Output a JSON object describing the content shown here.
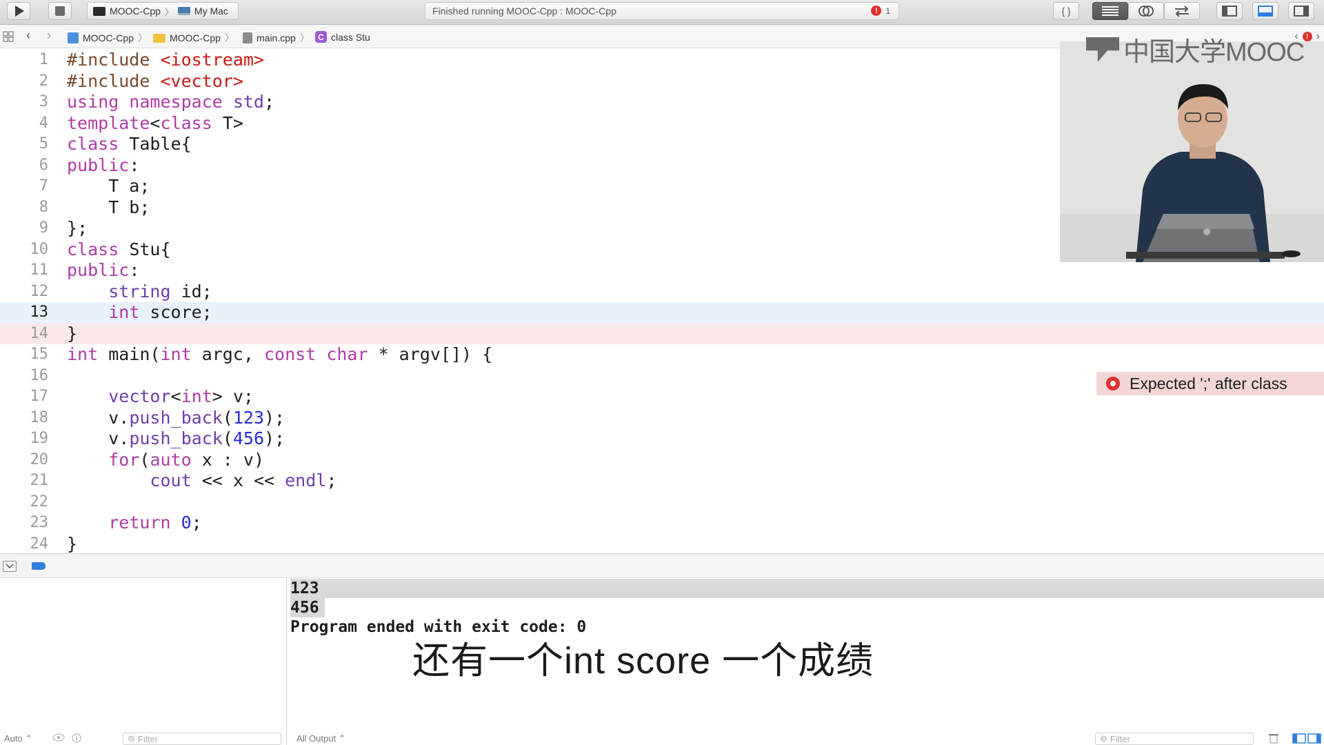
{
  "toolbar": {
    "scheme_name": "MOOC-Cpp",
    "destination": "My Mac",
    "activity_text": "Finished running MOOC-Cpp : MOOC-Cpp",
    "error_count": "1",
    "error_badge": "!",
    "braces_label": "{ }"
  },
  "jumpbar": {
    "project": "MOOC-Cpp",
    "folder": "MOOC-Cpp",
    "file": "main.cpp",
    "class_badge": "C",
    "symbol": "class Stu"
  },
  "editor": {
    "current_line": 13,
    "error_line": 14,
    "issue_message": "Expected ';' after class",
    "lines": [
      {
        "n": "1"
      },
      {
        "n": "2"
      },
      {
        "n": "3"
      },
      {
        "n": "4"
      },
      {
        "n": "5"
      },
      {
        "n": "6"
      },
      {
        "n": "7"
      },
      {
        "n": "8"
      },
      {
        "n": "9"
      },
      {
        "n": "10"
      },
      {
        "n": "11"
      },
      {
        "n": "12"
      },
      {
        "n": "13"
      },
      {
        "n": "14"
      },
      {
        "n": "15"
      },
      {
        "n": "16"
      },
      {
        "n": "17"
      },
      {
        "n": "18"
      },
      {
        "n": "19"
      },
      {
        "n": "20"
      },
      {
        "n": "21"
      },
      {
        "n": "22"
      },
      {
        "n": "23"
      },
      {
        "n": "24"
      }
    ],
    "code": {
      "l1a": "#include ",
      "l1b": "<iostream>",
      "l2a": "#include ",
      "l2b": "<vector>",
      "l3a": "using namespace ",
      "l3b": "std",
      "l3c": ";",
      "l4a": "template",
      "l4b": "<",
      "l4c": "class",
      "l4d": " T>",
      "l5a": "class",
      "l5b": " Table{",
      "l6a": "public",
      "l6b": ":",
      "l7": "    T a;",
      "l8": "    T b;",
      "l9": "};",
      "l10a": "class",
      "l10b": " Stu{",
      "l11a": "public",
      "l11b": ":",
      "l12a": "    ",
      "l12b": "string",
      "l12c": " id;",
      "l13a": "    ",
      "l13b": "int",
      "l13c": " score;",
      "l14": "}",
      "l15a": "int",
      "l15b": " main(",
      "l15c": "int",
      "l15d": " argc, ",
      "l15e": "const",
      "l15f": " ",
      "l15g": "char",
      "l15h": " * argv[]) {",
      "l16": "",
      "l17a": "    ",
      "l17b": "vector",
      "l17c": "<",
      "l17d": "int",
      "l17e": "> v;",
      "l18a": "    v.",
      "l18b": "push_back",
      "l18c": "(",
      "l18d": "123",
      "l18e": ");",
      "l19a": "    v.",
      "l19b": "push_back",
      "l19c": "(",
      "l19d": "456",
      "l19e": ");",
      "l20a": "    ",
      "l20b": "for",
      "l20c": "(",
      "l20d": "auto",
      "l20e": " x : v)",
      "l21a": "        ",
      "l21b": "cout",
      "l21c": " << x << ",
      "l21d": "endl",
      "l21e": ";",
      "l22": "",
      "l23a": "    ",
      "l23b": "return",
      "l23c": " ",
      "l23d": "0",
      "l23e": ";",
      "l24": "}"
    }
  },
  "video": {
    "watermark": "中国大学MOOC"
  },
  "console": {
    "output": [
      "123",
      "456",
      "Program ended with exit code: 0"
    ]
  },
  "bottombar": {
    "auto_label": "Auto ⌃",
    "filter_placeholder": "Filter",
    "output_selector": "All Output ⌃"
  },
  "subtitle": "还有一个int score 一个成绩",
  "colors": {
    "keyword": "#ad3da4",
    "preprocessor": "#78492a",
    "string": "#c41a16",
    "type": "#703daa",
    "number": "#272ad8",
    "error": "#e0312b",
    "current_line_bg": "#e9f1fb",
    "error_line_bg": "#fbe9e9"
  }
}
